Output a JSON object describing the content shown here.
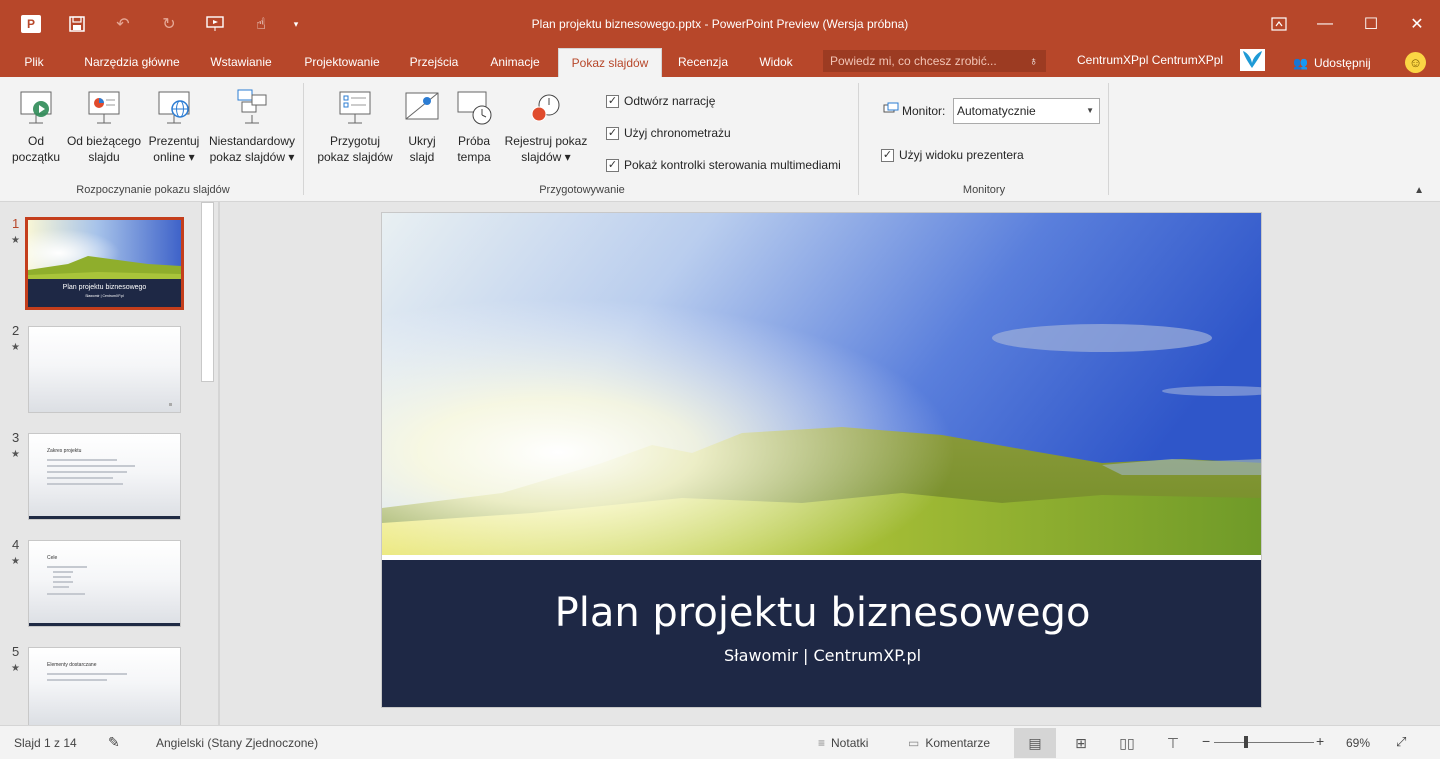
{
  "window": {
    "title": "Plan projektu biznesowego.pptx - PowerPoint Preview (Wersja próbna)",
    "app_badge": "P",
    "qat": [
      "save-icon",
      "undo-icon",
      "redo-icon",
      "present-from-start-icon",
      "touch-mode-icon",
      "customize-qat-icon"
    ],
    "controls": [
      "ribbon-display-icon",
      "minimize-icon",
      "maximize-icon",
      "close-icon"
    ]
  },
  "tabs": [
    "Plik",
    "Narzędzia główne",
    "Wstawianie",
    "Projektowanie",
    "Przejścia",
    "Animacje",
    "Pokaz slajdów",
    "Recenzja",
    "Widok"
  ],
  "active_tab": "Pokaz slajdów",
  "tellme": {
    "placeholder": "Powiedz mi, co chcesz zrobić..."
  },
  "user": {
    "name": "CentrumXPpl CentrumXPpl",
    "share": "Udostępnij"
  },
  "ribbon": {
    "group_start": {
      "label": "Rozpoczynanie pokazu slajdów",
      "buttons": [
        {
          "line1": "Od",
          "line2": "początku"
        },
        {
          "line1": "Od bieżącego",
          "line2": "slajdu"
        },
        {
          "line1": "Prezentuj",
          "line2": "online ▾"
        },
        {
          "line1": "Niestandardowy",
          "line2": "pokaz slajdów ▾"
        }
      ]
    },
    "group_setup": {
      "label": "Przygotowywanie",
      "buttons": [
        {
          "line1": "Przygotuj",
          "line2": "pokaz slajdów"
        },
        {
          "line1": "Ukryj",
          "line2": "slajd"
        },
        {
          "line1": "Próba",
          "line2": "tempa"
        },
        {
          "line1": "Rejestruj pokaz",
          "line2": "slajdów ▾"
        }
      ],
      "checks": [
        {
          "label": "Odtwórz narrację",
          "checked": true
        },
        {
          "label": "Użyj chronometrażu",
          "checked": true
        },
        {
          "label": "Pokaż kontrolki sterowania multimediami",
          "checked": true
        }
      ]
    },
    "group_monitors": {
      "label": "Monitory",
      "monitor_label": "Monitor:",
      "monitor_value": "Automatycznie",
      "presenter_view": {
        "label": "Użyj widoku prezentera",
        "checked": true
      }
    }
  },
  "thumbnails": [
    {
      "num": "1",
      "title": "Plan projektu biznesowego",
      "subtitle": "Sławomir | CentrumXP.pl"
    },
    {
      "num": "2",
      "title": ""
    },
    {
      "num": "3",
      "title": "Zakres projektu"
    },
    {
      "num": "4",
      "title": "Cele"
    },
    {
      "num": "5",
      "title": "Elementy dostarczane"
    }
  ],
  "slide": {
    "title": "Plan projektu biznesowego",
    "subtitle": "Sławomir | CentrumXP.pl"
  },
  "status": {
    "slide_info": "Slajd 1 z 14",
    "language": "Angielski (Stany Zjednoczone)",
    "notes": "Notatki",
    "comments": "Komentarze",
    "zoom": "69%"
  }
}
